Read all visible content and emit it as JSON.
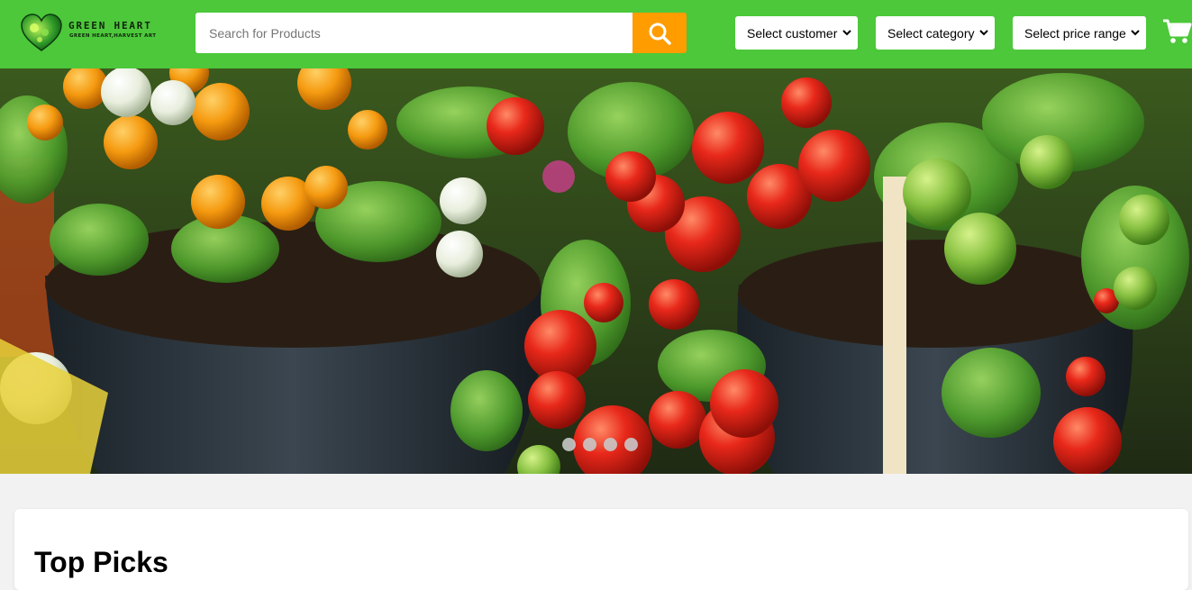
{
  "header": {
    "logo": {
      "title": "GREEN  HEART",
      "subtitle": "GREEN HEART,HARVEST ART"
    },
    "search": {
      "placeholder": "Search for Products",
      "value": "",
      "button_icon": "search-icon"
    },
    "filters": {
      "customer": "Select customer",
      "category": "Select category",
      "price_range": "Select price range"
    },
    "cart_icon": "cart-icon"
  },
  "hero": {
    "subject": "potted tomato plants",
    "slide_count": 4
  },
  "main": {
    "section_title": "Top Picks"
  },
  "colors": {
    "header_green": "#4cc83a",
    "search_button_orange": "#ff9c00",
    "page_background": "#f2f2f2"
  }
}
